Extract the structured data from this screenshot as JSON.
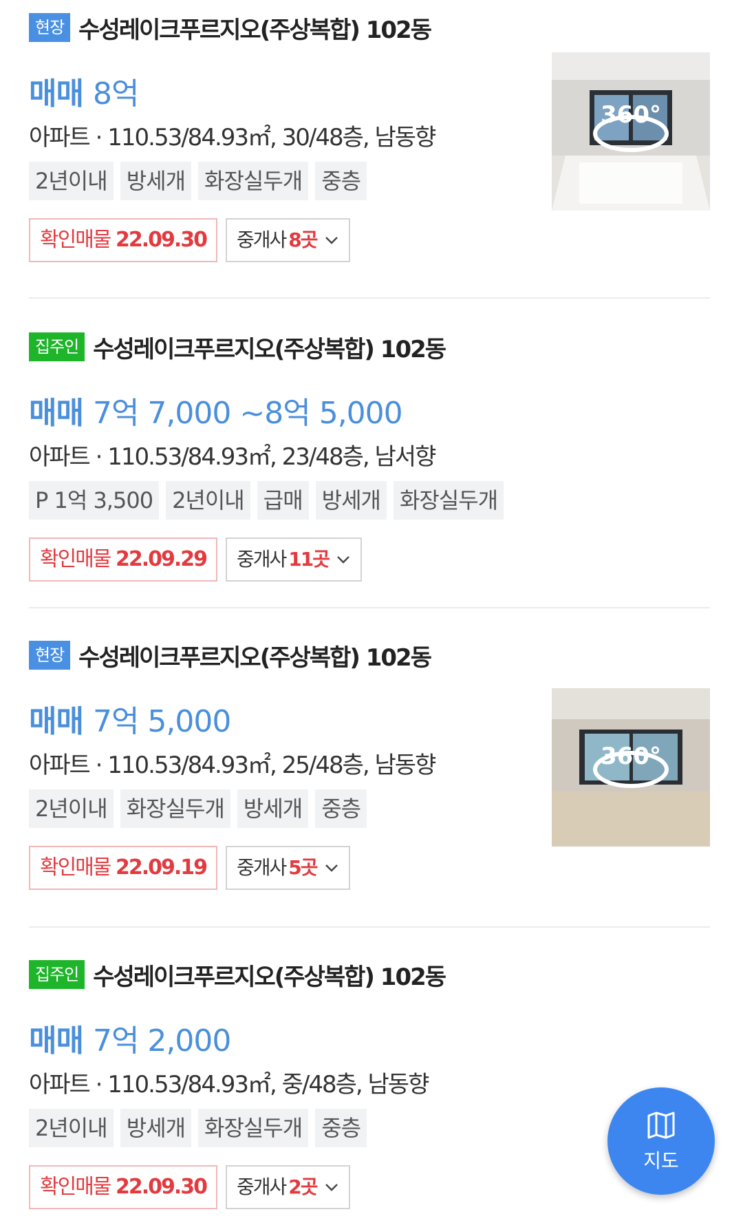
{
  "listings": [
    {
      "badge": "현장",
      "title": "수성레이크푸르지오(주상복합) 102동",
      "price_kind": "매매",
      "price_value": "8억",
      "spec": "아파트 · 110.53/84.93㎡, 30/48층, 남동향",
      "tags": [
        "2년이내",
        "방세개",
        "화장실두개",
        "중층"
      ],
      "confirm_label": "확인매물",
      "confirm_date": "22.09.30",
      "broker_label": "중개사",
      "broker_count": "8곳",
      "has_360": true
    },
    {
      "badge": "집주인",
      "title": "수성레이크푸르지오(주상복합) 102동",
      "price_kind": "매매",
      "price_value": "7억 7,000 ~8억 5,000",
      "spec": "아파트 · 110.53/84.93㎡, 23/48층, 남서향",
      "tags": [
        "P 1억 3,500",
        "2년이내",
        "급매",
        "방세개",
        "화장실두개"
      ],
      "confirm_label": "확인매물",
      "confirm_date": "22.09.29",
      "broker_label": "중개사",
      "broker_count": "11곳",
      "has_360": false
    },
    {
      "badge": "현장",
      "title": "수성레이크푸르지오(주상복합) 102동",
      "price_kind": "매매",
      "price_value": "7억 5,000",
      "spec": "아파트 · 110.53/84.93㎡, 25/48층, 남동향",
      "tags": [
        "2년이내",
        "화장실두개",
        "방세개",
        "중층"
      ],
      "confirm_label": "확인매물",
      "confirm_date": "22.09.19",
      "broker_label": "중개사",
      "broker_count": "5곳",
      "has_360": true
    },
    {
      "badge": "집주인",
      "title": "수성레이크푸르지오(주상복합) 102동",
      "price_kind": "매매",
      "price_value": "7억 2,000",
      "spec": "아파트 · 110.53/84.93㎡, 중/48층, 남동향",
      "tags": [
        "2년이내",
        "방세개",
        "화장실두개",
        "중층"
      ],
      "confirm_label": "확인매물",
      "confirm_date": "22.09.30",
      "broker_label": "중개사",
      "broker_count": "2곳",
      "has_360": false
    }
  ],
  "fab": {
    "label": "지도",
    "icon": "map-icon"
  },
  "colors": {
    "price": "#4a8fdc",
    "badge_site": "#4a90e2",
    "badge_owner": "#1eb52a",
    "confirm": "#e23a3f",
    "fab": "#3d86f0"
  }
}
